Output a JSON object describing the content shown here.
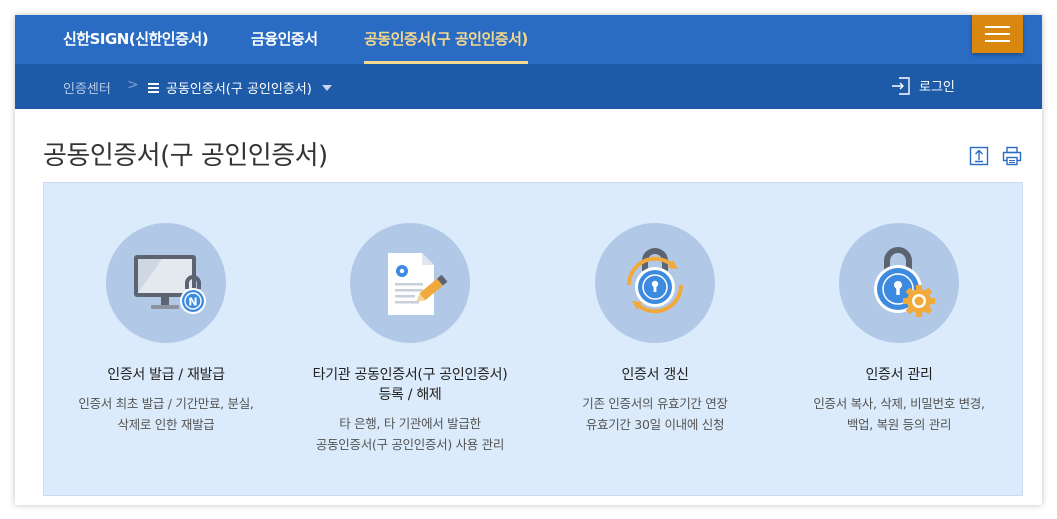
{
  "nav": {
    "tabs": [
      {
        "label": "신한SIGN(신한인증서)"
      },
      {
        "label": "금융인증서"
      },
      {
        "label": "공동인증서(구 공인인증서)"
      }
    ],
    "active_tab": 2,
    "menu_icon": "hamburger-icon"
  },
  "breadcrumb": {
    "home": "인증센터",
    "separator": ">",
    "current": "공동인증서(구 공인인증서)"
  },
  "login_label": "로그인",
  "page_title": "공동인증서(구 공인인증서)",
  "tools": {
    "share_icon": "share-icon",
    "print_icon": "print-icon"
  },
  "cards": [
    {
      "title": "인증서 발급 / 재발급",
      "desc_lines": [
        "인증서 최초 발급 / 기간만료, 분실,",
        "삭제로 인한 재발급"
      ],
      "icon": "monitor-lock-icon"
    },
    {
      "title_lines": [
        "타기관 공동인증서(구 공인인증서)",
        "등록 / 해제"
      ],
      "desc_lines": [
        "타 은행, 타 기관에서 발급한",
        "공동인증서(구 공인인증서) 사용 관리"
      ],
      "icon": "document-pen-icon"
    },
    {
      "title": "인증서 갱신",
      "desc_lines": [
        "기존 인증서의 유효기간 연장",
        "유효기간 30일 이내에 신청"
      ],
      "icon": "lock-refresh-icon"
    },
    {
      "title": "인증서 관리",
      "desc_lines": [
        "인증서 복사, 삭제, 비밀번호 변경,",
        "백업, 복원 등의 관리"
      ],
      "icon": "lock-gear-icon"
    }
  ],
  "colors": {
    "top_nav": "#2a6cc4",
    "sub_nav": "#1d5aa8",
    "active_tab": "#f5d98e",
    "menu_button": "#d9870e",
    "panel_bg": "#dcebfb",
    "icon_circle": "#b1c9e7"
  }
}
